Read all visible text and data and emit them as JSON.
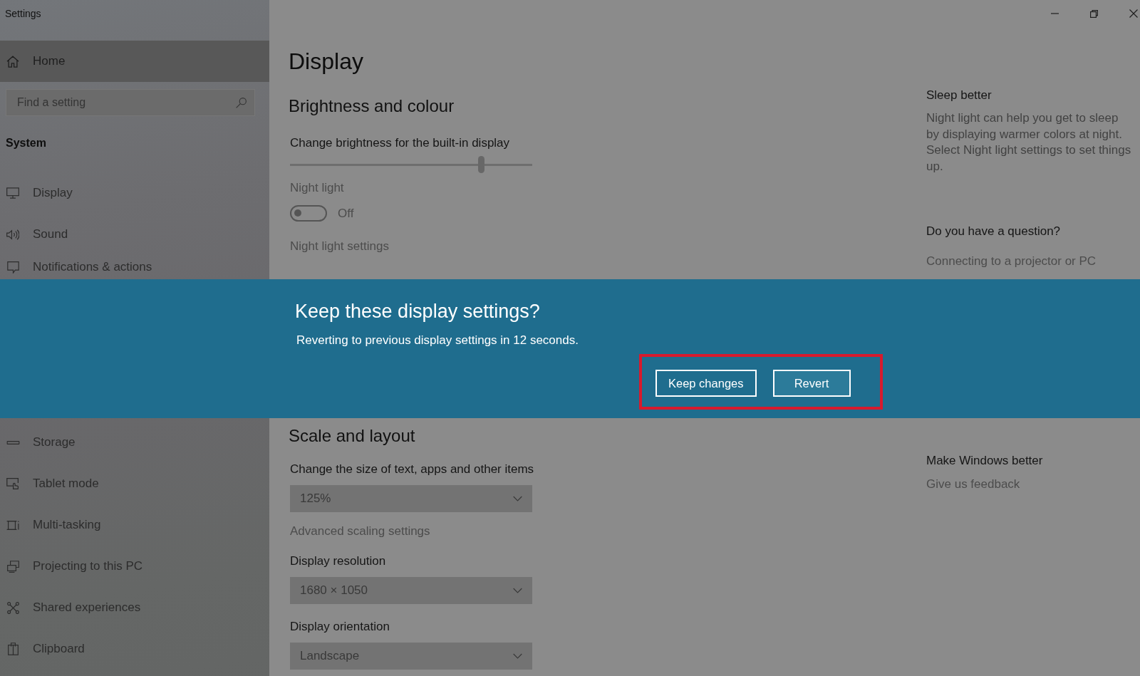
{
  "window": {
    "title": "Settings"
  },
  "sidebar": {
    "home": {
      "label": "Home",
      "hovered": true
    },
    "search": {
      "placeholder": "Find a setting"
    },
    "heading": "System",
    "items_above_dialog": [
      {
        "label": "Display"
      },
      {
        "label": "Sound"
      },
      {
        "label": "Notifications & actions"
      }
    ],
    "items_below_dialog": [
      {
        "label": "Storage"
      },
      {
        "label": "Tablet mode"
      },
      {
        "label": "Multi-tasking"
      },
      {
        "label": "Projecting to this PC"
      },
      {
        "label": "Shared experiences"
      },
      {
        "label": "Clipboard"
      }
    ]
  },
  "main": {
    "title": "Display",
    "brightness": {
      "heading": "Brightness and colour",
      "slider": {
        "label": "Change brightness for the built-in display",
        "level": 0.79
      },
      "night_light": {
        "label": "Night light",
        "on": false,
        "state_text": "Off",
        "disabled": true
      },
      "link": "Night light settings"
    },
    "scale": {
      "heading": "Scale and layout",
      "rows": [
        {
          "kind": "dropdown",
          "label": "Change the size of text, apps and other items",
          "value": "125%"
        },
        {
          "kind": "link",
          "label": "Advanced scaling settings"
        },
        {
          "kind": "dropdown",
          "label": "Display resolution",
          "value": "1680 × 1050"
        },
        {
          "kind": "dropdown",
          "label": "Display orientation",
          "value": "Landscape"
        }
      ]
    }
  },
  "aside": {
    "above_dialog": [
      {
        "heading": "Sleep better",
        "text": "Night light can help you get to sleep by displaying warmer colors at night. Select Night light settings to set things up."
      },
      {
        "heading": "Do you have a question?",
        "link": "Connecting to a projector or PC"
      }
    ],
    "below_dialog": [
      {
        "heading": "Make Windows better",
        "link": "Give us feedback"
      }
    ]
  },
  "dialog": {
    "title": "Keep these display settings?",
    "message": "Reverting to previous display settings in 12 seconds.",
    "buttons": [
      {
        "label": "Keep changes",
        "hovered": false
      },
      {
        "label": "Revert",
        "hovered": true
      }
    ]
  }
}
